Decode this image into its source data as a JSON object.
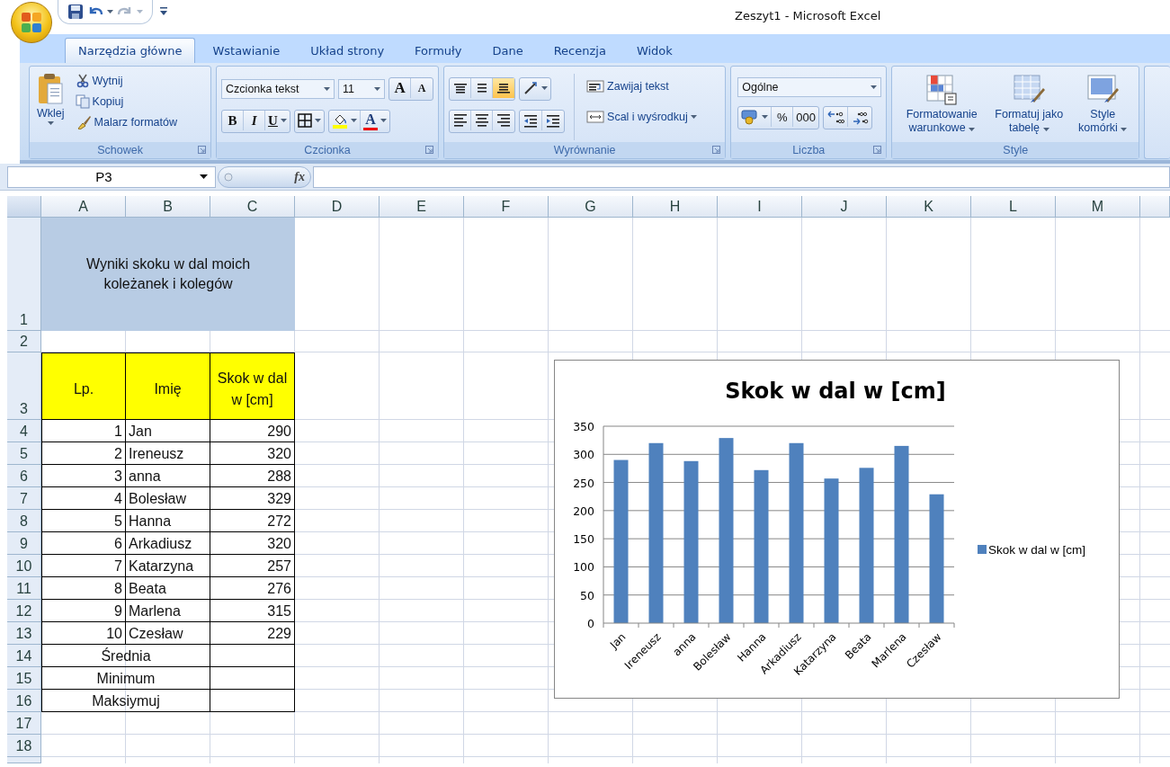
{
  "window": {
    "title": "Zeszyt1 - Microsoft Excel"
  },
  "ribbon": {
    "tabs": [
      {
        "label": "Narzędzia główne",
        "selected": true
      },
      {
        "label": "Wstawianie",
        "selected": false
      },
      {
        "label": "Układ strony",
        "selected": false
      },
      {
        "label": "Formuły",
        "selected": false
      },
      {
        "label": "Dane",
        "selected": false
      },
      {
        "label": "Recenzja",
        "selected": false
      },
      {
        "label": "Widok",
        "selected": false
      }
    ],
    "groups": [
      {
        "kind": "clipboard",
        "label": "Schowek",
        "launcher": true,
        "paste": "Wklej",
        "commands": [
          "Wytnij",
          "Kopiuj",
          "Malarz formatów"
        ]
      },
      {
        "kind": "font",
        "label": "Czcionka",
        "launcher": true,
        "font_name": "Czcionka tekst",
        "font_size": "11",
        "grow": "A",
        "shrink": "A",
        "bold": "B",
        "italic": "I",
        "underline": "U",
        "font_color": "A"
      },
      {
        "kind": "alignment",
        "label": "Wyrównanie",
        "launcher": true,
        "vertical": [
          {
            "selected": false
          },
          {
            "selected": false
          },
          {
            "selected": true
          }
        ],
        "wrap": "Zawijaj tekst",
        "merge": "Scal i wyśrodkuj"
      },
      {
        "kind": "number",
        "label": "Liczba",
        "launcher": true,
        "format": "Ogólne",
        "percent": "%",
        "thousands": "000"
      },
      {
        "kind": "styles",
        "label": "Style",
        "launcher": false,
        "commands": [
          "Formatowanie warunkowe",
          "Formatuj jako tabelę",
          "Style komórki"
        ]
      }
    ]
  },
  "formula_bar": {
    "name_box": "P3",
    "function_label": "fx"
  },
  "sheet": {
    "columns": [
      "A",
      "B",
      "C",
      "D",
      "E",
      "F",
      "G",
      "H",
      "I",
      "J",
      "K",
      "L",
      "M"
    ],
    "row_numbers": [
      "1",
      "2",
      "3",
      "4",
      "5",
      "6",
      "7",
      "8",
      "9",
      "10",
      "11",
      "12",
      "13",
      "14",
      "15",
      "16",
      "17",
      "18"
    ],
    "title": "Wyniki skoku w dal moich koleżanek i kolegów",
    "header": [
      "Lp.",
      "Imię",
      "Skok w dal w [cm]"
    ],
    "records": [
      {
        "lp": "1",
        "name": "Jan",
        "score": "290"
      },
      {
        "lp": "2",
        "name": "Ireneusz",
        "score": "320"
      },
      {
        "lp": "3",
        "name": "anna",
        "score": "288"
      },
      {
        "lp": "4",
        "name": "Bolesław",
        "score": "329"
      },
      {
        "lp": "5",
        "name": "Hanna",
        "score": "272"
      },
      {
        "lp": "6",
        "name": "Arkadiusz",
        "score": "320"
      },
      {
        "lp": "7",
        "name": "Katarzyna",
        "score": "257"
      },
      {
        "lp": "8",
        "name": "Beata",
        "score": "276"
      },
      {
        "lp": "9",
        "name": "Marlena",
        "score": "315"
      },
      {
        "lp": "10",
        "name": "Czesław",
        "score": "229"
      }
    ],
    "summary": [
      "Średnia",
      "Minimum",
      "Maksiymuj"
    ]
  },
  "chart": {
    "chart_data": {
      "type": "bar",
      "title": "Skok w dal w [cm]",
      "categories": [
        "Jan",
        "Ireneusz",
        "anna",
        "Bolesław",
        "Hanna",
        "Arkadiusz",
        "Katarzyna",
        "Beata",
        "Marlena",
        "Czesław"
      ],
      "series": [
        {
          "name": "Skok w dal w [cm]",
          "color": "#4f81bd",
          "values": [
            290,
            320,
            288,
            329,
            272,
            320,
            257,
            276,
            315,
            229
          ]
        }
      ],
      "grid": true,
      "ylim": [
        0,
        350
      ],
      "yticks": [
        0,
        50,
        100,
        150,
        200,
        250,
        300,
        350
      ]
    }
  }
}
